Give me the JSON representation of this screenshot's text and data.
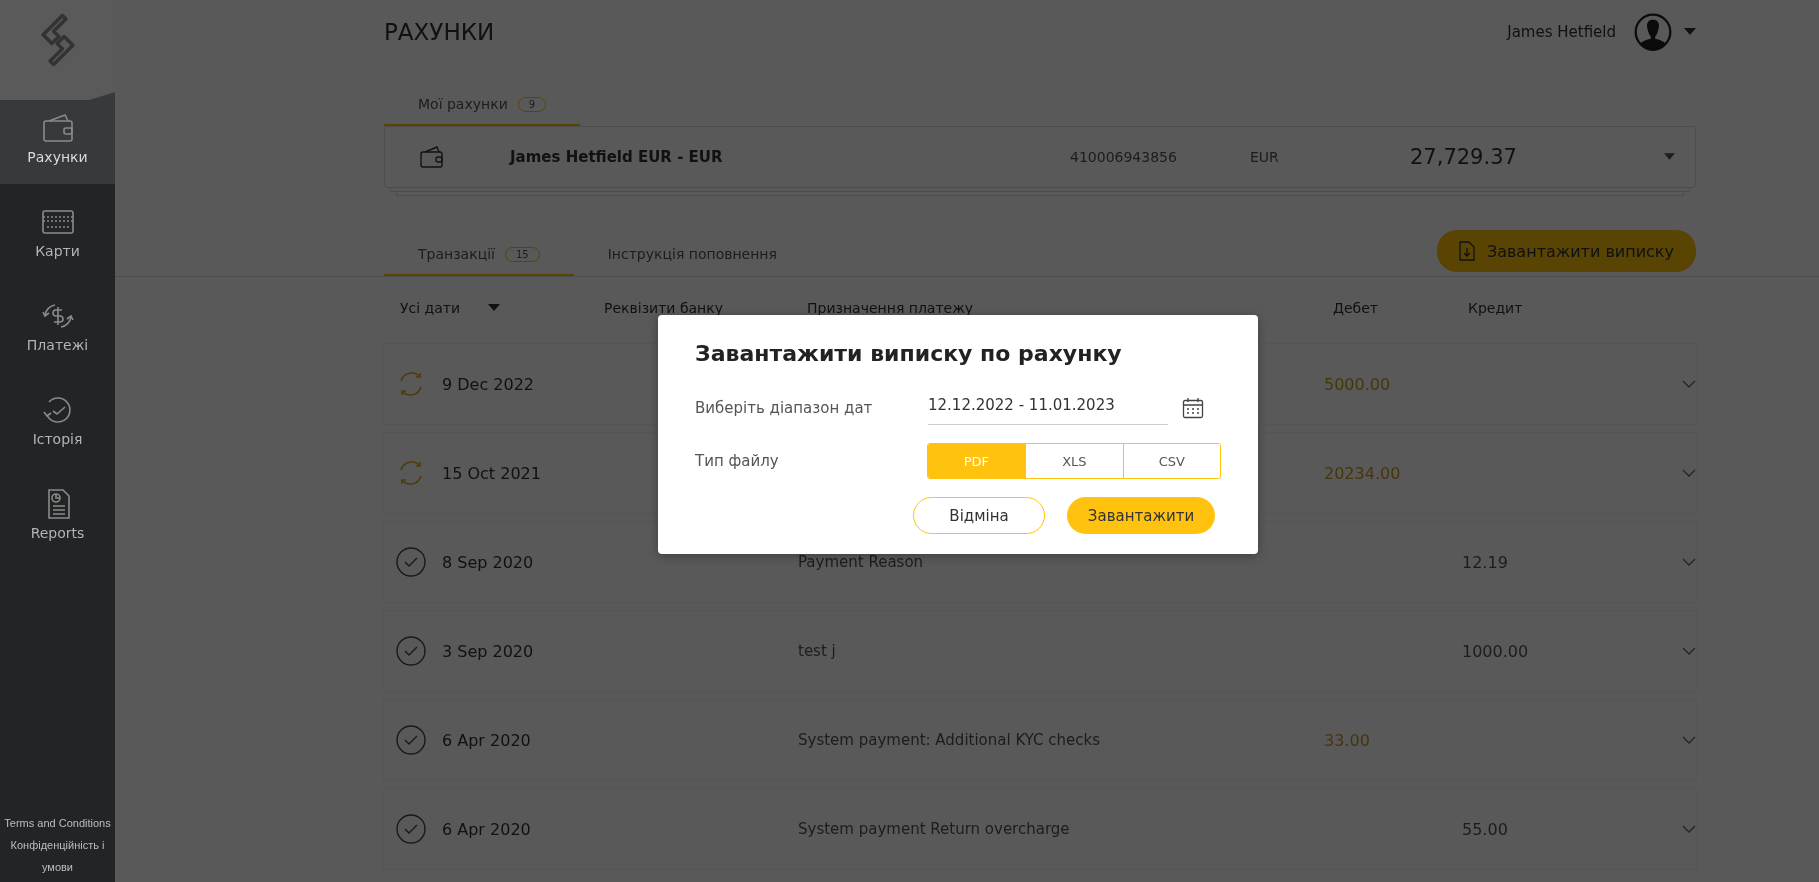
{
  "sidebar": {
    "items": [
      {
        "label": "Рахунки",
        "kind": "wallet",
        "selected": true
      },
      {
        "label": "Карти",
        "kind": "card",
        "selected": false
      },
      {
        "label": "Платежі",
        "kind": "payments",
        "selected": false
      },
      {
        "label": "Історія",
        "kind": "history",
        "selected": false
      },
      {
        "label": "Reports",
        "kind": "report",
        "selected": false
      }
    ],
    "footer_links": [
      "Terms and Conditions",
      "Конфіденційність і умови"
    ]
  },
  "header": {
    "title": "РАХУНКИ",
    "user_name": "James Hetfield"
  },
  "account_tabs": [
    {
      "label": "Мої рахунки",
      "count": "9",
      "selected": true
    }
  ],
  "account": {
    "name": "James Hetfield EUR - EUR",
    "number": "410006943856",
    "currency": "EUR",
    "balance": "27,729.37"
  },
  "transaction_tabs": [
    {
      "label": "Транзакції",
      "count": "15",
      "selected": true
    },
    {
      "label": "Інструкція поповнення",
      "selected": false
    }
  ],
  "download_button": "Завантажити виписку",
  "table": {
    "columns": [
      "Усі дати",
      "Реквізити банку",
      "Призначення платежу",
      "Дебет",
      "Кредит"
    ],
    "rows": [
      {
        "kind": "pending",
        "date": "9 Dec 2022",
        "debit": "5000.00"
      },
      {
        "kind": "pending",
        "date": "15 Oct 2021",
        "debit": "20234.00"
      },
      {
        "kind": "completed",
        "date": "8 Sep 2020",
        "purpose": "Payment Reason",
        "credit": "12.19"
      },
      {
        "kind": "completed",
        "date": "3 Sep 2020",
        "purpose": "test j",
        "credit": "1000.00"
      },
      {
        "kind": "completed",
        "date": "6 Apr 2020",
        "purpose": "System payment: Additional KYC checks",
        "debit": "33.00"
      },
      {
        "kind": "completed",
        "date": "6 Apr 2020",
        "purpose": "System payment Return overcharge",
        "credit": "55.00"
      }
    ]
  },
  "modal": {
    "title": "Завантажити виписку по рахунку",
    "date_label": "Виберіть діапазон дат",
    "date_value": "12.12.2022 - 11.01.2023",
    "file_type_label": "Тип файлу",
    "file_types": [
      {
        "label": "PDF",
        "selected": true
      },
      {
        "label": "XLS",
        "selected": false
      },
      {
        "label": "CSV",
        "selected": false
      }
    ],
    "cancel_button": "Відміна",
    "confirm_button": "Завантажити"
  }
}
